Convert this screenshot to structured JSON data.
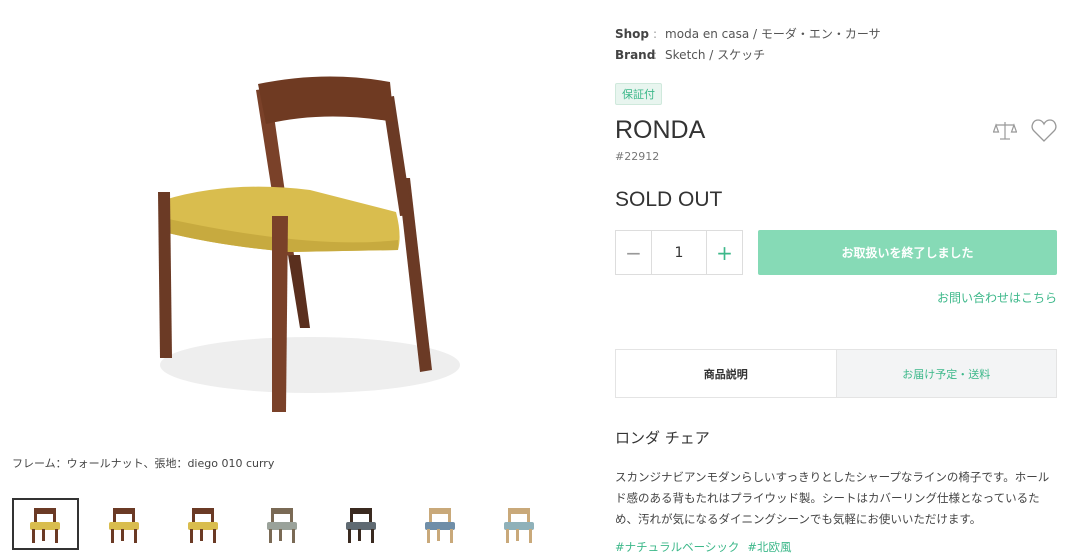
{
  "product": {
    "shop_label": "Shop",
    "shop_value": "moda en casa / モーダ・エン・カーサ",
    "brand_label": "Brand",
    "brand_value": "Sketch / スケッチ",
    "badge": "保証付",
    "name": "RONDA",
    "sku": "#22912",
    "status": "SOLD OUT",
    "quantity": "1",
    "cta_label": "お取扱いを終了しました",
    "contact_link": "お問い合わせはこちら"
  },
  "gallery": {
    "caption": "フレーム：ウォールナット、張地：diego 010 curry",
    "thumbnails": [
      {
        "name": "thumb-1",
        "seat_color": "#d9bd4e",
        "frame_color": "#6b3a25",
        "active": true
      },
      {
        "name": "thumb-2",
        "seat_color": "#d9bd4e",
        "frame_color": "#6b3a25"
      },
      {
        "name": "thumb-3",
        "seat_color": "#d9bd4e",
        "frame_color": "#6b3a25"
      },
      {
        "name": "thumb-4",
        "seat_color": "#9aa29a",
        "frame_color": "#7a6a55"
      },
      {
        "name": "thumb-5",
        "seat_color": "#5f6a72",
        "frame_color": "#3a2a20"
      },
      {
        "name": "thumb-6",
        "seat_color": "#6f8ea8",
        "frame_color": "#c9a97a"
      },
      {
        "name": "thumb-7",
        "seat_color": "#8fb1b9",
        "frame_color": "#c9a97a"
      }
    ]
  },
  "tabs": {
    "description": "商品説明",
    "delivery": "お届け予定・送料"
  },
  "description": {
    "title": "ロンダ チェア",
    "body": "スカンジナビアンモダンらしいすっきりとしたシャープなラインの椅子です。ホールド感のある背もたれはプライウッド製。シートはカバーリング仕様となっているため、汚れが気になるダイニングシーンでも気軽にお使いいただけます。",
    "tags": [
      "#ナチュラルベーシック",
      "#北欧風"
    ]
  },
  "colors": {
    "accent": "#3db88a",
    "cta_bg": "#86dab6"
  },
  "icons": [
    "compare-scale-icon",
    "heart-icon"
  ]
}
